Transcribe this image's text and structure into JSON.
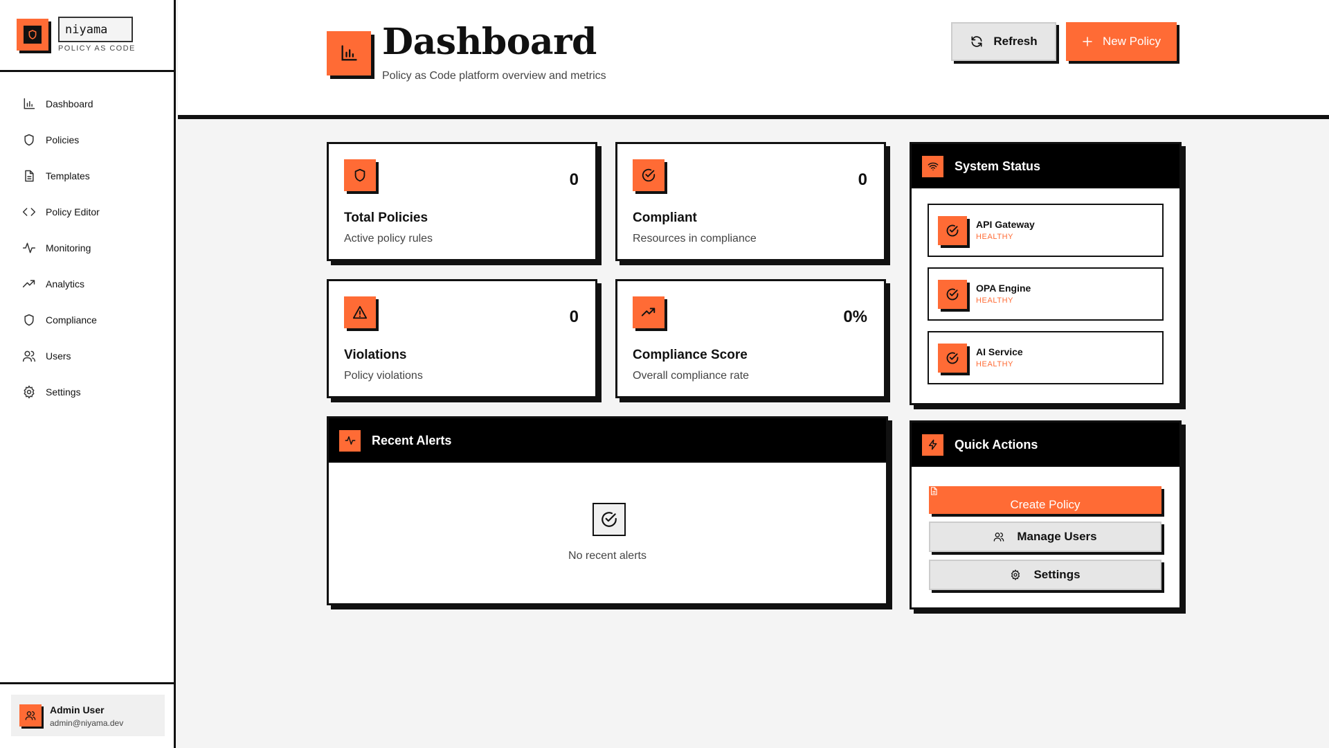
{
  "brand": {
    "name": "niyama",
    "tagline": "POLICY AS CODE"
  },
  "sidebar": {
    "items": [
      {
        "label": "Dashboard",
        "icon": "bar-chart-icon"
      },
      {
        "label": "Policies",
        "icon": "shield-icon"
      },
      {
        "label": "Templates",
        "icon": "document-icon"
      },
      {
        "label": "Policy Editor",
        "icon": "code-icon"
      },
      {
        "label": "Monitoring",
        "icon": "activity-icon"
      },
      {
        "label": "Analytics",
        "icon": "trending-up-icon"
      },
      {
        "label": "Compliance",
        "icon": "shield-icon"
      },
      {
        "label": "Users",
        "icon": "users-icon"
      },
      {
        "label": "Settings",
        "icon": "gear-icon"
      }
    ]
  },
  "user": {
    "name": "Admin User",
    "email": "admin@niyama.dev"
  },
  "header": {
    "title": "Dashboard",
    "subtitle": "Policy as Code platform overview and metrics",
    "refresh_label": "Refresh",
    "new_policy_label": "New Policy"
  },
  "stats": [
    {
      "label": "Total Policies",
      "desc": "Active policy rules",
      "value": "0",
      "icon": "shield-icon"
    },
    {
      "label": "Compliant",
      "desc": "Resources in compliance",
      "value": "0",
      "icon": "check-circle-icon"
    },
    {
      "label": "Violations",
      "desc": "Policy violations",
      "value": "0",
      "icon": "warning-triangle-icon"
    },
    {
      "label": "Compliance Score",
      "desc": "Overall compliance rate",
      "value": "0%",
      "icon": "trending-up-icon"
    }
  ],
  "alerts": {
    "title": "Recent Alerts",
    "empty_text": "No recent alerts"
  },
  "system_status": {
    "title": "System Status",
    "items": [
      {
        "name": "API Gateway",
        "state": "HEALTHY"
      },
      {
        "name": "OPA Engine",
        "state": "HEALTHY"
      },
      {
        "name": "AI Service",
        "state": "HEALTHY"
      }
    ]
  },
  "quick_actions": {
    "title": "Quick Actions",
    "create_policy": "Create Policy",
    "manage_users": "Manage Users",
    "settings": "Settings"
  },
  "colors": {
    "accent": "#ff6b35",
    "dark": "#111111",
    "background": "#f4f4f4"
  }
}
